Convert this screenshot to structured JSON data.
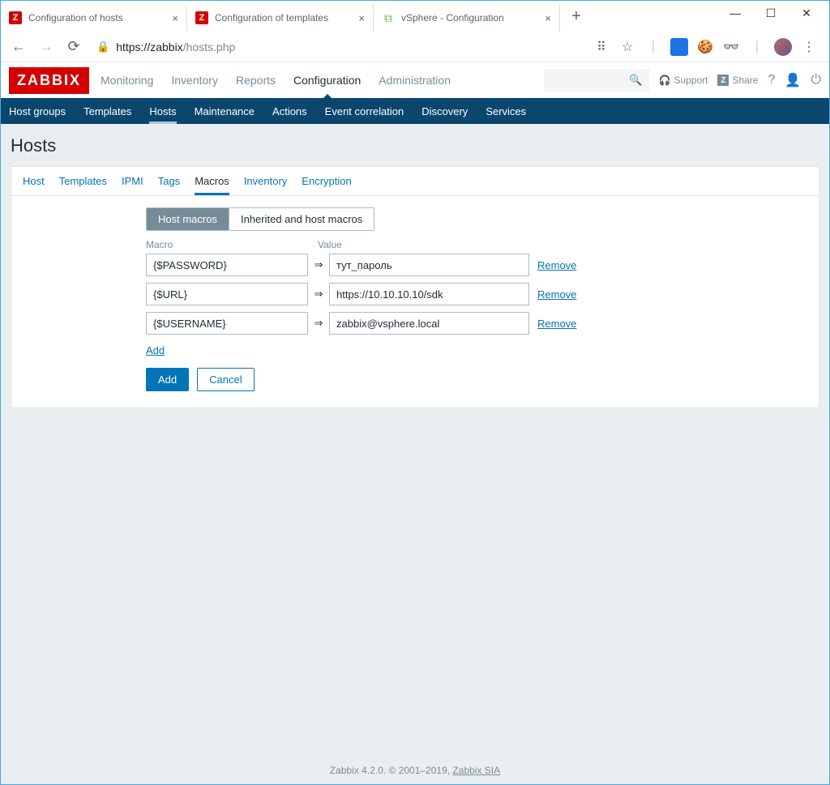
{
  "browser": {
    "tabs": [
      {
        "title": "Configuration of hosts",
        "favicon": "Z"
      },
      {
        "title": "Configuration of templates",
        "favicon": "Z"
      },
      {
        "title": "vSphere - Configuration",
        "favicon": "V"
      }
    ],
    "url_host": "https://zabbix",
    "url_path": "/hosts.php"
  },
  "zabbix": {
    "logo": "ZABBIX",
    "nav": [
      "Monitoring",
      "Inventory",
      "Reports",
      "Configuration",
      "Administration"
    ],
    "nav_active": 3,
    "support": "Support",
    "share": "Share",
    "subnav": [
      "Host groups",
      "Templates",
      "Hosts",
      "Maintenance",
      "Actions",
      "Event correlation",
      "Discovery",
      "Services"
    ],
    "subnav_active": 2
  },
  "page": {
    "title": "Hosts",
    "tabs": [
      "Host",
      "Templates",
      "IPMI",
      "Tags",
      "Macros",
      "Inventory",
      "Encryption"
    ],
    "tabs_active": 4,
    "radio": {
      "a": "Host macros",
      "b": "Inherited and host macros"
    },
    "head_macro": "Macro",
    "head_value": "Value",
    "macros": [
      {
        "name": "{$PASSWORD}",
        "value": "тут_пароль"
      },
      {
        "name": "{$URL}",
        "value": "https://10.10.10.10/sdk"
      },
      {
        "name": "{$USERNAME}",
        "value": "zabbix@vsphere.local"
      }
    ],
    "remove": "Remove",
    "add_link": "Add",
    "btn_add": "Add",
    "btn_cancel": "Cancel"
  },
  "footer": {
    "text": "Zabbix 4.2.0. © 2001–2019, ",
    "link": "Zabbix SIA"
  }
}
